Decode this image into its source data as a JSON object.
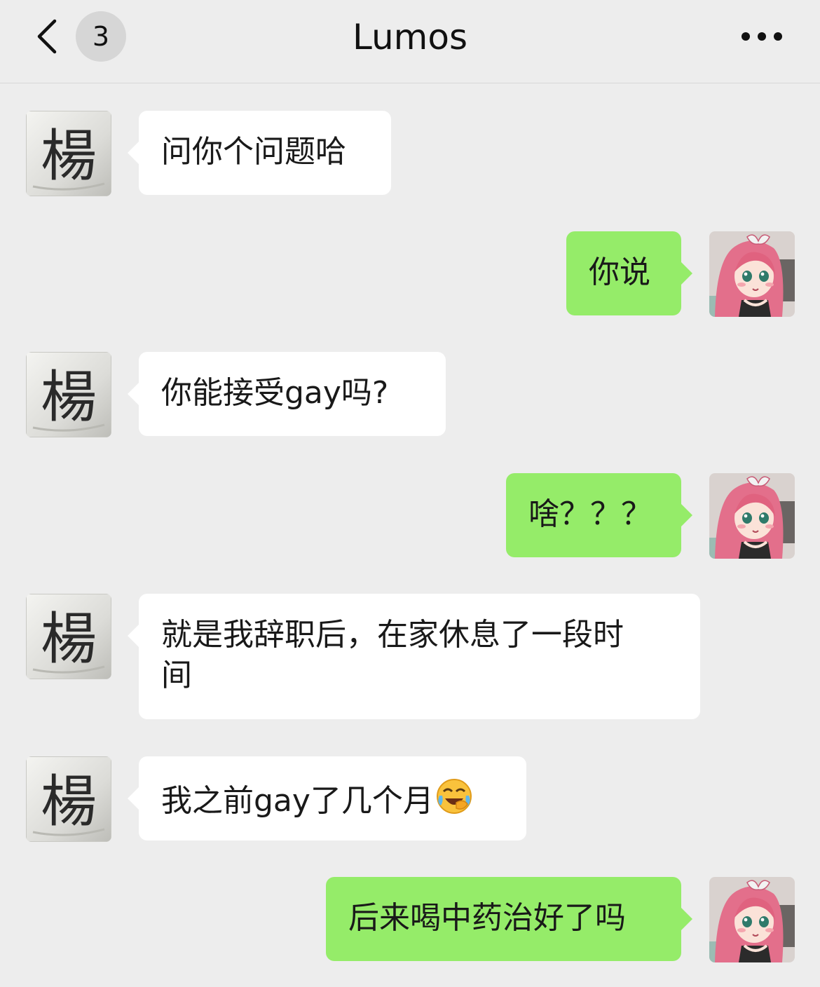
{
  "header": {
    "back_icon": "chevron-left-icon",
    "unread_count": "3",
    "title": "Lumos",
    "more_icon": "more-dots-icon"
  },
  "contact": {
    "avatar_glyph": "楊"
  },
  "messages": [
    {
      "side": "left",
      "text": "问你个问题哈"
    },
    {
      "side": "right",
      "text": "你说"
    },
    {
      "side": "left",
      "text": "你能接受gay吗?"
    },
    {
      "side": "right",
      "text": "啥？？？"
    },
    {
      "side": "left",
      "text_line1": "就是我辞职后，在家休息了一段时",
      "text_line2": "间"
    },
    {
      "side": "left",
      "text": "我之前gay了几个月",
      "emoji": "crying-laughing-face-icon"
    },
    {
      "side": "right",
      "text": "后来喝中药治好了吗"
    }
  ],
  "colors": {
    "background": "#ededed",
    "incoming_bubble": "#ffffff",
    "outgoing_bubble": "#95ec69"
  }
}
